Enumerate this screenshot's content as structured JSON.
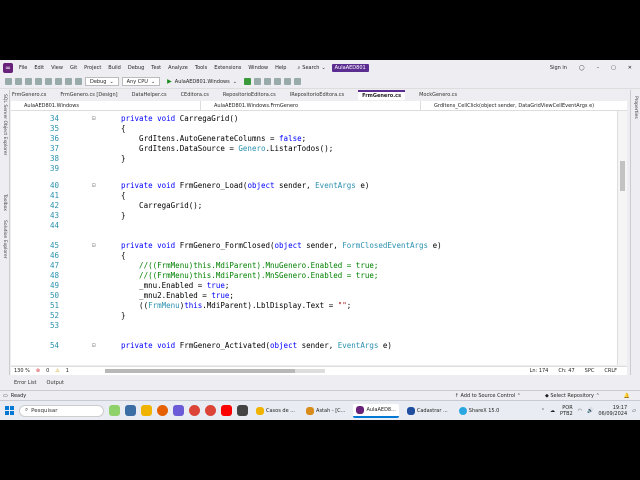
{
  "menubar": {
    "items": [
      "File",
      "Edit",
      "View",
      "Git",
      "Project",
      "Build",
      "Debug",
      "Test",
      "Analyze",
      "Tools",
      "Extensions",
      "Window",
      "Help"
    ],
    "search_label": "Search",
    "solution_name": "AulaAED801",
    "sign_in": "Sign in"
  },
  "toolbar": {
    "config": "Debug",
    "platform": "Any CPU",
    "run_target": "AulaAED801.Windows"
  },
  "doc_tabs": [
    "FrmGenero.cs",
    "FrmGenero.cs [Design]",
    "DataHelper.cs",
    "CEditora.cs",
    "RepositorioEditora.cs",
    "IRepositorioEditora.cs",
    "FrmGenero.cs",
    "MockGenero.cs"
  ],
  "active_tab_index": 6,
  "left_rail": [
    "SQL Server Object Explorer",
    "Toolbox",
    "Solution Explorer"
  ],
  "right_rail": "Properties",
  "navbar": {
    "project": "AulaAED801.Windows",
    "class": "AulaAED801.Windows.FrmGenero",
    "member": "GrdItens_CellClick(object sender, DataGridViewCellEventArgs e)"
  },
  "code_lines": [
    {
      "n": "34",
      "parts": [
        [
          "kw",
          "private "
        ],
        [
          "kw",
          "void "
        ],
        [
          "",
          "CarregaGrid()"
        ]
      ]
    },
    {
      "n": "35",
      "parts": [
        [
          "",
          "{"
        ]
      ]
    },
    {
      "n": "36",
      "parts": [
        [
          "",
          "    GrdItens.AutoGenerateColumns = "
        ],
        [
          "kw",
          "false"
        ],
        [
          "",
          ";"
        ]
      ]
    },
    {
      "n": "37",
      "parts": [
        [
          "",
          "    GrdItens.DataSource = "
        ],
        [
          "ty",
          "Genero"
        ],
        [
          "",
          ".ListarTodos();"
        ]
      ]
    },
    {
      "n": "38",
      "parts": [
        [
          "",
          "}"
        ]
      ]
    },
    {
      "n": "39",
      "parts": []
    },
    {
      "n": "40",
      "parts": [
        [
          "kw",
          "private "
        ],
        [
          "kw",
          "void "
        ],
        [
          "",
          "FrmGenero_Load("
        ],
        [
          "kw",
          "object "
        ],
        [
          "",
          "sender, "
        ],
        [
          "ty",
          "EventArgs "
        ],
        [
          "",
          "e)"
        ]
      ]
    },
    {
      "n": "41",
      "parts": [
        [
          "",
          "{"
        ]
      ]
    },
    {
      "n": "42",
      "parts": [
        [
          "",
          "    CarregaGrid();"
        ]
      ]
    },
    {
      "n": "43",
      "parts": [
        [
          "",
          "}"
        ]
      ]
    },
    {
      "n": "44",
      "parts": []
    },
    {
      "n": "45",
      "parts": [
        [
          "kw",
          "private "
        ],
        [
          "kw",
          "void "
        ],
        [
          "",
          "FrmGenero_FormClosed("
        ],
        [
          "kw",
          "object "
        ],
        [
          "",
          "sender, "
        ],
        [
          "ty",
          "FormClosedEventArgs "
        ],
        [
          "",
          "e)"
        ]
      ]
    },
    {
      "n": "46",
      "parts": [
        [
          "",
          "{"
        ]
      ]
    },
    {
      "n": "47",
      "parts": [
        [
          "cm",
          "    //((FrmMenu)this.MdiParent).MnuGenero.Enabled = true;"
        ]
      ]
    },
    {
      "n": "48",
      "parts": [
        [
          "cm",
          "    //((FrmMenu)this.MdiParent).MnSGenero.Enabled = true;"
        ]
      ]
    },
    {
      "n": "49",
      "parts": [
        [
          "",
          "    _mnu.Enabled = "
        ],
        [
          "kw",
          "true"
        ],
        [
          "",
          ";"
        ]
      ]
    },
    {
      "n": "50",
      "parts": [
        [
          "",
          "    _mnu2.Enabled = "
        ],
        [
          "kw",
          "true"
        ],
        [
          "",
          ";"
        ]
      ]
    },
    {
      "n": "51",
      "parts": [
        [
          "",
          "    (("
        ],
        [
          "ty",
          "FrmMenu"
        ],
        [
          "",
          ")"
        ],
        [
          "kw",
          "this"
        ],
        [
          "",
          ".MdiParent).LblDisplay.Text = "
        ],
        [
          "st",
          "\"\""
        ],
        [
          "",
          ";"
        ]
      ]
    },
    {
      "n": "52",
      "parts": [
        [
          "",
          "}"
        ]
      ]
    },
    {
      "n": "53",
      "parts": []
    },
    {
      "n": "54",
      "parts": [
        [
          "kw",
          "private "
        ],
        [
          "kw",
          "void "
        ],
        [
          "",
          "FrmGenero_Activated("
        ],
        [
          "kw",
          "object "
        ],
        [
          "",
          "sender, "
        ],
        [
          "ty",
          "EventArgs "
        ],
        [
          "",
          "e)"
        ]
      ]
    }
  ],
  "editor_status": {
    "zoom": "130 %",
    "errors": "0",
    "warnings": "1",
    "line": "Ln: 174",
    "col": "Ch: 47",
    "spacing": "SPC",
    "eol": "CRLF"
  },
  "panel_tabs": [
    "Error List",
    "Output"
  ],
  "status_bar": {
    "state": "Ready",
    "source_control": "Add to Source Control",
    "repository": "Select Repository"
  },
  "taskbar": {
    "search_placeholder": "Pesquisar",
    "tasks": [
      "Casos de ...",
      "Astah - [C...",
      "AulaAED8...",
      "Cadastrar ...",
      "ShareX 15.0"
    ],
    "lang": "POR",
    "layout": "PTB2",
    "time": "19:17",
    "date": "06/09/2024"
  }
}
